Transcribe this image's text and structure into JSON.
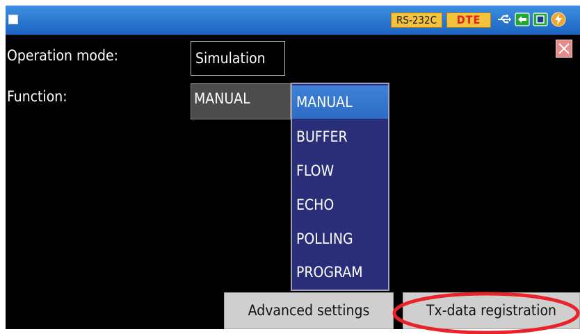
{
  "status_bar": {
    "port": "RS-232C",
    "mode": "DTE",
    "icons": [
      "usb-icon",
      "link-icon",
      "storage-icon",
      "power-icon"
    ]
  },
  "form": {
    "operation_mode_label": "Operation mode:",
    "operation_mode_value": "Simulation",
    "function_label": "Function:",
    "function_value": "MANUAL"
  },
  "dropdown": {
    "selected": "MANUAL",
    "options": [
      "MANUAL",
      "BUFFER",
      "FLOW",
      "ECHO",
      "POLLING",
      "PROGRAM"
    ]
  },
  "buttons": {
    "advanced": "Advanced settings",
    "tx_data": "Tx-data registration"
  },
  "colors": {
    "titlebar": "#1f6fd0",
    "badge": "#f4c23c",
    "dropdown_bg": "#2a2e78",
    "selected_option": "#3272cc",
    "annotation_circle": "#e8232a"
  }
}
